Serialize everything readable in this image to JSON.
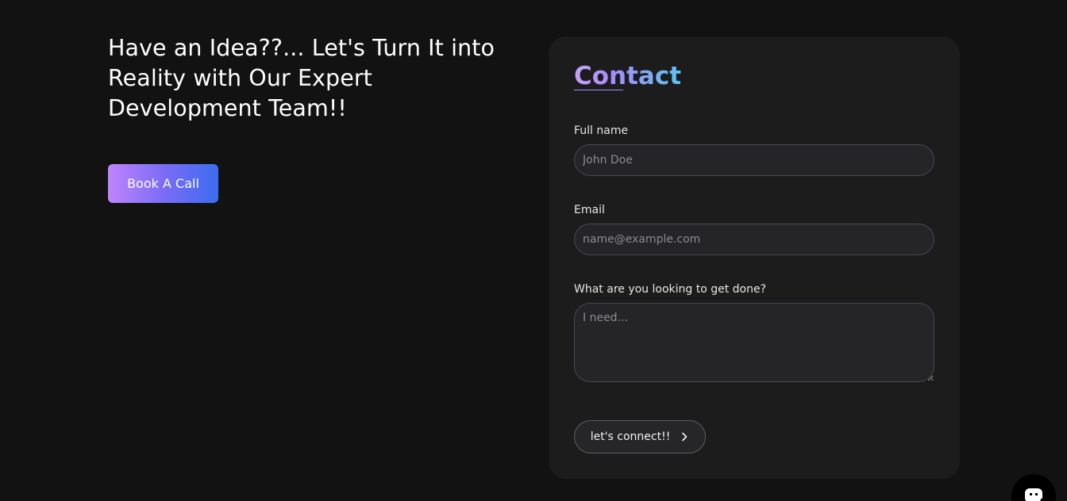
{
  "hero": {
    "title": "Have an Idea??... Let's Turn It into Reality with Our Expert Development Team!!",
    "cta_label": "Book A Call"
  },
  "contact_form": {
    "title": "Contact",
    "fields": {
      "full_name": {
        "label": "Full name",
        "placeholder": "John Doe",
        "value": ""
      },
      "email": {
        "label": "Email",
        "placeholder": "name@example.com",
        "value": ""
      },
      "request": {
        "label": "What are you looking to get done?",
        "placeholder": "I need...",
        "value": ""
      }
    },
    "submit_label": "let's connect!!",
    "submit_icon": "chevron-right-icon"
  },
  "chat_widget": {
    "icon": "chat-icon"
  },
  "colors": {
    "background": "#121212",
    "card": "#1c1c1d",
    "accent_gradient_start": "#c084fc",
    "accent_gradient_end": "#3b6cf0",
    "title_gradient_end": "#5ec3f0"
  }
}
